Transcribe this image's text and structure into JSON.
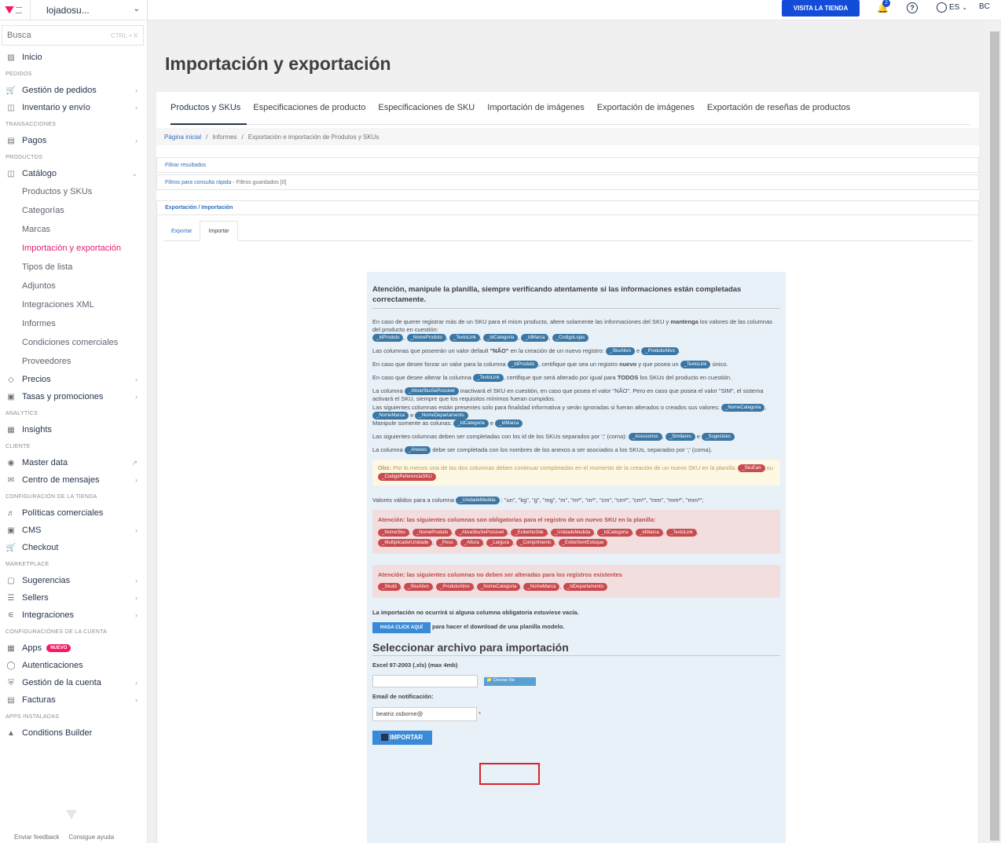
{
  "account": {
    "name": "lojadosu..."
  },
  "search": {
    "placeholder": "Busca",
    "shortcut": "CTRL + K"
  },
  "sidebar": {
    "home": "Inicio",
    "sec_pedidos": "PEDIDOS",
    "gestion": "Gestión de pedidos",
    "inventario": "Inventario y envío",
    "sec_trans": "TRANSACCIONES",
    "pagos": "Pagos",
    "sec_prod": "PRODUCTOS",
    "catalogo": "Catálogo",
    "sub": [
      "Productos y SKUs",
      "Categorías",
      "Marcas",
      "Importación y exportación",
      "Tipos de lista",
      "Adjuntos",
      "Integraciones XML",
      "Informes",
      "Condiciones comerciales",
      "Proveedores"
    ],
    "precios": "Precios",
    "tasas": "Tasas y promociones",
    "sec_analytics": "ANALYTICS",
    "insights": "Insights",
    "sec_cliente": "CLIENTE",
    "master": "Master data",
    "centro": "Centro de mensajes",
    "sec_config": "CONFIGURACIÓN DE LA TIENDA",
    "politicas": "Políticas comerciales",
    "cms": "CMS",
    "checkout": "Checkout",
    "sec_market": "MARKETPLACE",
    "sugerencias": "Sugerencias",
    "sellers": "Sellers",
    "integraciones": "Integraciones",
    "sec_cuenta": "CONFIGURACIÓNES DE LA CUENTA",
    "apps": "Apps",
    "apps_badge": "NUEVO",
    "autenticaciones": "Autenticaciones",
    "gestion_cuenta": "Gestión de la cuenta",
    "facturas": "Facturas",
    "sec_instaladas": "APPS INSTALADAS",
    "conditions": "Conditions Builder",
    "feedback": "Enviar feedback",
    "ayuda": "Consigue ayuda"
  },
  "topbar": {
    "visit": "VISITA LA TIENDA",
    "notif_count": "2",
    "lang": "ES",
    "user": "BC"
  },
  "page": {
    "title": "Importación y exportación",
    "tabs": [
      "Productos y SKUs",
      "Especificaciones de producto",
      "Especificaciones de SKU",
      "Importación de imágenes",
      "Exportación de imágenes",
      "Exportación de reseñas de productos"
    ],
    "crumb": [
      "Página inicial",
      "Informes",
      "Exportación e importación de Produtos y SKUs"
    ],
    "filter": "Filtrar resultados",
    "quick": "Filtros para consulta rápida",
    "saved": "- Filtros guardados [0]",
    "exphead": "Exportación / Importación",
    "subtabs": [
      "Exportar",
      "Importar"
    ]
  },
  "import": {
    "heading": "Atención, manipule la planilla, siempre verificando atentamente si las informaciones están completadas correctamente.",
    "p1a": "En caso de querer registrar más de un SKU para el mism producto, altere solamente las informaciones del SKU y",
    "p1b": "mantenga",
    "p1c": "los valores de las columnas del producto en cuestión:",
    "p1tags": [
      "_IdProduto",
      "_NomeProduto",
      "_TextoLink",
      "_IdCategoria",
      "_IdMarca",
      "_CodigoLojas"
    ],
    "p2a": "Las columnas que poseerán un valor default",
    "p2b": "\"NÃO\"",
    "p2c": "en la creación de un nuevo registro:",
    "p2tags": [
      "_SkuAtivo",
      "_ProdutoAtivo"
    ],
    "p3a": "En caso que desee forzar un valor para la columna",
    "p3tag": "_IdProduto",
    "p3b": ", certifique que sea un registro",
    "p3c": "nuevo",
    "p3d": "y que posea un",
    "p3tag2": "_TextoLink",
    "p3e": "único.",
    "p4a": "En caso que desee alterar la columna",
    "p4tag": "_TextoLink",
    "p4b": ", certifique que será alterado por igual para",
    "p4c": "TODOS",
    "p4d": "los SKUs del producto en cuestión.",
    "p5a": "La columna",
    "p5tag": "_AtivarSkuSePossivel",
    "p5b": "inactivará el SKU en cuestión, en caso que posea el valor \"NÃO\". Pero en caso que posea el valor \"SIM\", el sistema activará el SKU, siempre que los requisitos mínimos fueran cumpidos.",
    "p6a": "Las siguientes columnas están presentes solo para finalidad informativa y serán ignoradas si fueran alterados o creados sus valores:",
    "p6tags": [
      "_NomeCategoria",
      "_NomeMarca",
      "_NomeDepartamento"
    ],
    "p6b": "Manipule somente as colunas:",
    "p6tags2": [
      "_IdCategoria",
      "_IdMarca"
    ],
    "p7a": "Las siguientes columnas deben ser completadas con los id de los SKUs separados por ';' (coma):",
    "p7tags": [
      "_Acessorios",
      "_Similares",
      "_Sugestoes"
    ],
    "p8a": "La columna",
    "p8tag": "_Anexos",
    "p8b": "debe ser completada con los nombres de los anexos a ser asociados a los SKUs, separados por ';' (coma).",
    "obs_b": "Obs:",
    "obs": "Por lo menos una de las dos columnas deben continuar completadas en el momento de la creación de un nuevo SKU en la planilla:",
    "obs_tags": [
      "_SkuEan",
      "_CodigoReferenciaSKU"
    ],
    "obs_or": "ou",
    "val_a": "Valores válidos para a columna",
    "val_tag": "_UnidadeMedida",
    "val_b": ": \"un\", \"kg\", \"g\", \"mg\", \"m\", \"m²\", \"m³\", \"cm\", \"cm²\", \"cm³\", \"mm\", \"mm²\", \"mm³\";",
    "alert1": "Atención: las siguientes columnas son obligatorias para el registro de un nuevo SKU en la planilla:",
    "alert1_tags": [
      "_NomeSku",
      "_NomeProduto",
      "_AtivaSkuSePossivel",
      "_ExibeNoSite",
      "_UnidadeMedida",
      "_IdCategoria",
      "_IdMarca",
      "_TextoLink",
      "_MultiplicadorUnidade",
      "_Peso",
      "_Altura",
      "_Largura",
      "_Comprimento",
      "_ExibeSemEstoque"
    ],
    "alert2": "Atención: las siguientes columnas no deben ser alteradas para los registros existentes",
    "alert2_tags": [
      "_SkuId",
      "_SkuAtivo",
      "_ProdutoAtivo",
      "_NomeCategoria",
      "_NomeMarca",
      "_IdDepartamento"
    ],
    "empty_note": "La importación no ocurrirá si alguna columna obligatoria estuviese vacía.",
    "dl_button": "HAGA CLICK AQUÍ",
    "dl_text": "para hacer el download de una planilla modelo.",
    "select_title": "Seleccionar archivo para importación",
    "file_label": "Excel 97-2003 (.xls) (max 4mb)",
    "choose_file": "Choose file",
    "email_label": "Email de notificación:",
    "email_value": "beatriz.osborne@",
    "import_button": "IMPORTAR"
  }
}
